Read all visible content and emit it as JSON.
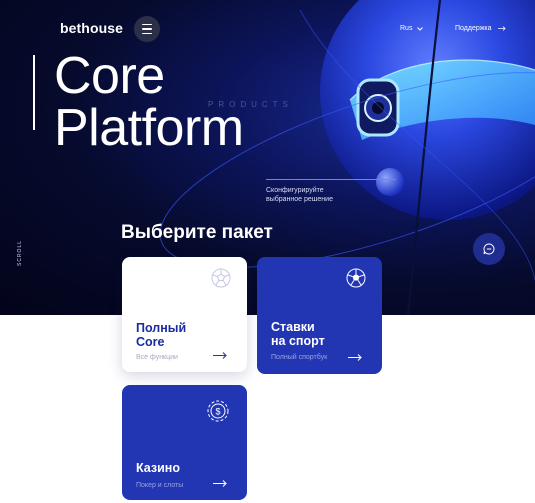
{
  "header": {
    "logo": "bethouse",
    "language": "Rus",
    "support": "Поддержка"
  },
  "hero": {
    "title_line1": "Core",
    "title_line2": "Platform",
    "products_label": "PRODUCTS",
    "subtitle_line1": "Сконфигурируйте",
    "subtitle_line2": "выбранное решение",
    "scroll_label": "SCROLL"
  },
  "packages": {
    "heading": "Выберите пакет",
    "cards": [
      {
        "title_line1": "Полный",
        "title_line2": "Core",
        "description": "Все функции",
        "icon": "soccer-ball-icon"
      },
      {
        "title_line1": "Ставки",
        "title_line2": "на спорт",
        "description": "Полный спортбук",
        "icon": "soccer-ball-icon"
      },
      {
        "title_line1": "Казино",
        "title_line2": "",
        "description": "Покер и слоты",
        "icon": "casino-chip-icon"
      }
    ]
  },
  "colors": {
    "hero_dark": "#060a2c",
    "accent_blue": "#2236b4",
    "card_white_title": "#1b2aa0"
  }
}
